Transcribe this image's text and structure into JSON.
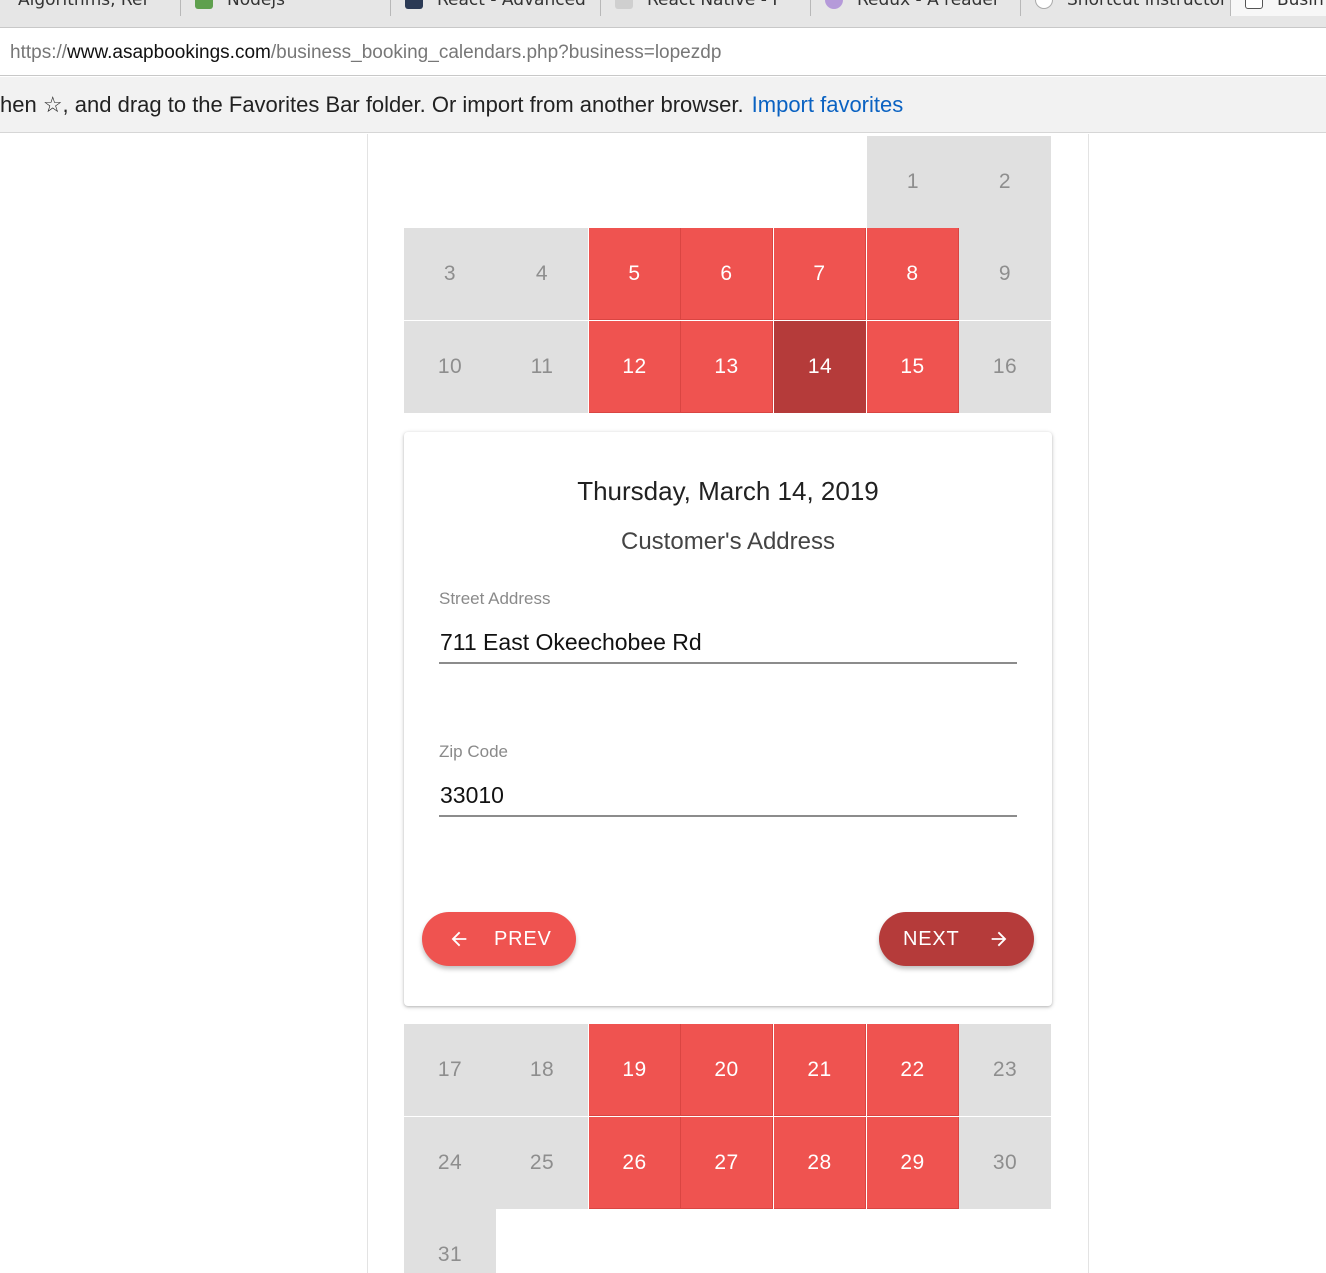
{
  "browser": {
    "tabs": [
      {
        "label": "Algorithms, Ref"
      },
      {
        "label": "Nodejs"
      },
      {
        "label": "React - Advanced"
      },
      {
        "label": "React Native - F"
      },
      {
        "label": "Redux - A reader"
      },
      {
        "label": "Shortcut instructor"
      },
      {
        "label": "Busin"
      }
    ],
    "url": {
      "scheme": "https://",
      "host": "www.asapbookings.com",
      "path": "/business_booking_calendars.php?business=lopezdp"
    },
    "favorites_bar": {
      "message": "hen ☆, and drag to the Favorites Bar folder. Or import from another browser.",
      "link": "Import favorites"
    }
  },
  "calendar": {
    "upper_days": {
      "d1": "1",
      "d2": "2",
      "d3": "3",
      "d4": "4",
      "d5": "5",
      "d6": "6",
      "d7": "7",
      "d8": "8",
      "d9": "9",
      "d10": "10",
      "d11": "11",
      "d12": "12",
      "d13": "13",
      "d14": "14",
      "d15": "15",
      "d16": "16"
    },
    "lower_days": {
      "d17": "17",
      "d18": "18",
      "d19": "19",
      "d20": "20",
      "d21": "21",
      "d22": "22",
      "d23": "23",
      "d24": "24",
      "d25": "25",
      "d26": "26",
      "d27": "27",
      "d28": "28",
      "d29": "29",
      "d30": "30",
      "d31": "31"
    },
    "selected_day": "14",
    "colors": {
      "available": "#ef5350",
      "selected": "#b53b3a",
      "unavailable": "#e0e0e0"
    }
  },
  "booking_card": {
    "date_title": "Thursday, March 14, 2019",
    "subtitle": "Customer's Address",
    "street": {
      "label": "Street Address",
      "value": "711 East Okeechobee Rd"
    },
    "zip": {
      "label": "Zip Code",
      "value": "33010"
    },
    "prev_label": "PREV",
    "next_label": "NEXT",
    "icons": {
      "prev": "arrow-left-icon",
      "next": "arrow-right-icon"
    }
  }
}
